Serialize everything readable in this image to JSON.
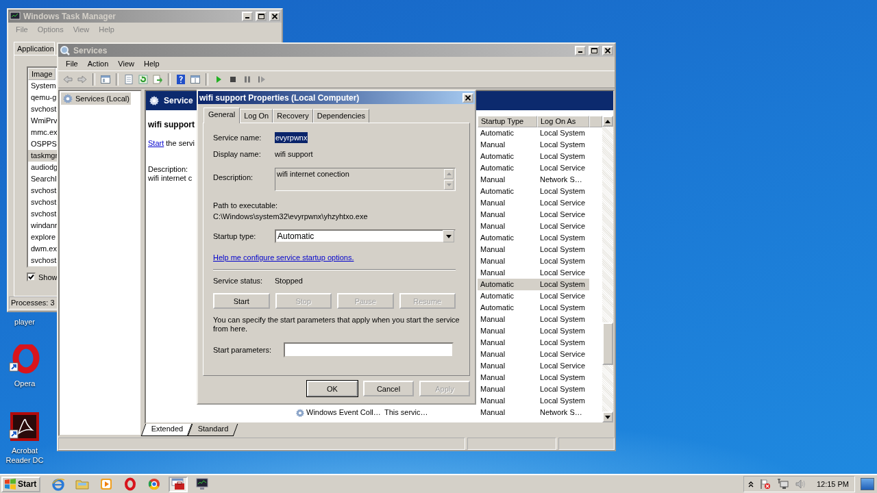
{
  "desktop_icons": [
    {
      "label": "player"
    },
    {
      "kind": "ring",
      "label": "Opera"
    },
    {
      "kind": "document",
      "label": "Acrobat Reader DC"
    }
  ],
  "task_manager": {
    "title": "Windows Task Manager",
    "active": false,
    "menu": [
      "File",
      "Options",
      "View",
      "Help"
    ],
    "tab": "Application",
    "column": "Image",
    "processes": [
      {
        "name": "System",
        "selected": false
      },
      {
        "name": "qemu-g",
        "selected": false
      },
      {
        "name": "svchost",
        "selected": false
      },
      {
        "name": "WmiPrv",
        "selected": false
      },
      {
        "name": "mmc.ex",
        "selected": false
      },
      {
        "name": "OSPPS",
        "selected": false
      },
      {
        "name": "taskmgr",
        "selected": true
      },
      {
        "name": "audiodg",
        "selected": false
      },
      {
        "name": "SearchI",
        "selected": false
      },
      {
        "name": "svchost",
        "selected": false
      },
      {
        "name": "svchost",
        "selected": false
      },
      {
        "name": "svchost",
        "selected": false
      },
      {
        "name": "windanr",
        "selected": false
      },
      {
        "name": "explore",
        "selected": false
      },
      {
        "name": "dwm.ex",
        "selected": false
      },
      {
        "name": "svchost",
        "selected": false
      }
    ],
    "show_all": {
      "label": "Show",
      "checked": true
    },
    "status": "Processes: 3"
  },
  "services": {
    "title": "Services",
    "active": false,
    "menu": [
      "File",
      "Action",
      "View",
      "Help"
    ],
    "tree_item": {
      "label": "Services (Local)",
      "selected": true
    },
    "header": "Service",
    "service_title": "wifi support",
    "action_link": "Start",
    "action_rest": " the servi",
    "description_label": "Description:",
    "description_text": "wifi internet c",
    "columns": [
      "Startup Type",
      "Log On As"
    ],
    "rows": [
      {
        "startup_type": "Automatic",
        "log_on_as": "Local System",
        "selected": false
      },
      {
        "startup_type": "Manual",
        "log_on_as": "Local System",
        "selected": false
      },
      {
        "startup_type": "Automatic",
        "log_on_as": "Local System",
        "selected": false
      },
      {
        "startup_type": "Automatic",
        "log_on_as": "Local Service",
        "selected": false
      },
      {
        "startup_type": "Manual",
        "log_on_as": "Network S…",
        "selected": false
      },
      {
        "startup_type": "Automatic",
        "log_on_as": "Local System",
        "selected": false
      },
      {
        "startup_type": "Manual",
        "log_on_as": "Local Service",
        "selected": false
      },
      {
        "startup_type": "Manual",
        "log_on_as": "Local Service",
        "selected": false
      },
      {
        "startup_type": "Manual",
        "log_on_as": "Local Service",
        "selected": false
      },
      {
        "startup_type": "Automatic",
        "log_on_as": "Local System",
        "selected": false
      },
      {
        "startup_type": "Manual",
        "log_on_as": "Local System",
        "selected": false
      },
      {
        "startup_type": "Manual",
        "log_on_as": "Local System",
        "selected": false
      },
      {
        "startup_type": "Manual",
        "log_on_as": "Local Service",
        "selected": false
      },
      {
        "startup_type": "Automatic",
        "log_on_as": "Local System",
        "selected": true
      },
      {
        "startup_type": "Automatic",
        "log_on_as": "Local Service",
        "selected": false
      },
      {
        "startup_type": "Automatic",
        "log_on_as": "Local System",
        "selected": false
      },
      {
        "startup_type": "Manual",
        "log_on_as": "Local System",
        "selected": false
      },
      {
        "startup_type": "Manual",
        "log_on_as": "Local System",
        "selected": false
      },
      {
        "startup_type": "Manual",
        "log_on_as": "Local System",
        "selected": false
      },
      {
        "startup_type": "Manual",
        "log_on_as": "Local Service",
        "selected": false
      },
      {
        "startup_type": "Manual",
        "log_on_as": "Local Service",
        "selected": false
      },
      {
        "startup_type": "Manual",
        "log_on_as": "Local System",
        "selected": false
      },
      {
        "startup_type": "Manual",
        "log_on_as": "Local System",
        "selected": false
      },
      {
        "startup_type": "Manual",
        "log_on_as": "Local System",
        "selected": false
      },
      {
        "name": "Windows Event Coll…",
        "description": "This servic…",
        "startup_type": "Manual",
        "log_on_as": "Network S…",
        "selected": false
      }
    ],
    "view_tabs": [
      {
        "label": "Extended",
        "selected": true
      },
      {
        "label": "Standard",
        "selected": false
      }
    ]
  },
  "dialog": {
    "title": "wifi support Properties (Local Computer)",
    "active": true,
    "tabs": [
      {
        "label": "General",
        "selected": true
      },
      {
        "label": "Log On",
        "selected": false
      },
      {
        "label": "Recovery",
        "selected": false
      },
      {
        "label": "Dependencies",
        "selected": false
      }
    ],
    "service_name": {
      "label": "Service name:",
      "value": "evyrpwnx",
      "highlighted": true
    },
    "display_name": {
      "label": "Display name:",
      "value": "wifi support"
    },
    "description": {
      "label": "Description:",
      "value": "wifi internet conection"
    },
    "path": {
      "label": "Path to executable:",
      "value": "C:\\Windows\\system32\\evyrpwnx\\yhzyhtxo.exe"
    },
    "startup_type": {
      "label": "Startup type:",
      "value": "Automatic"
    },
    "help_link": "Help me configure service startup options.",
    "status": {
      "label": "Service status:",
      "value": "Stopped"
    },
    "control_buttons": [
      {
        "label": "Start",
        "disabled": false
      },
      {
        "label": "Stop",
        "disabled": true
      },
      {
        "label": "Pause",
        "disabled": true
      },
      {
        "label": "Resume",
        "disabled": true
      }
    ],
    "note": "You can specify the start parameters that apply when you start the service from here.",
    "start_parameters": {
      "label": "Start parameters:"
    },
    "footer_buttons": [
      {
        "label": "OK",
        "disabled": false,
        "default": true
      },
      {
        "label": "Cancel",
        "disabled": false,
        "default": false
      },
      {
        "label": "Apply",
        "disabled": true,
        "default": false
      }
    ]
  },
  "taskbar": {
    "start": "Start",
    "apps": [
      {
        "kind": "browser",
        "selected": false
      },
      {
        "kind": "folder",
        "selected": false
      },
      {
        "kind": "player",
        "selected": false
      },
      {
        "kind": "ring",
        "selected": false
      },
      {
        "kind": "round",
        "selected": false
      },
      {
        "kind": "toolbox",
        "selected": true
      },
      {
        "kind": "monitor",
        "selected": false
      }
    ],
    "clock": "12:15 PM"
  }
}
